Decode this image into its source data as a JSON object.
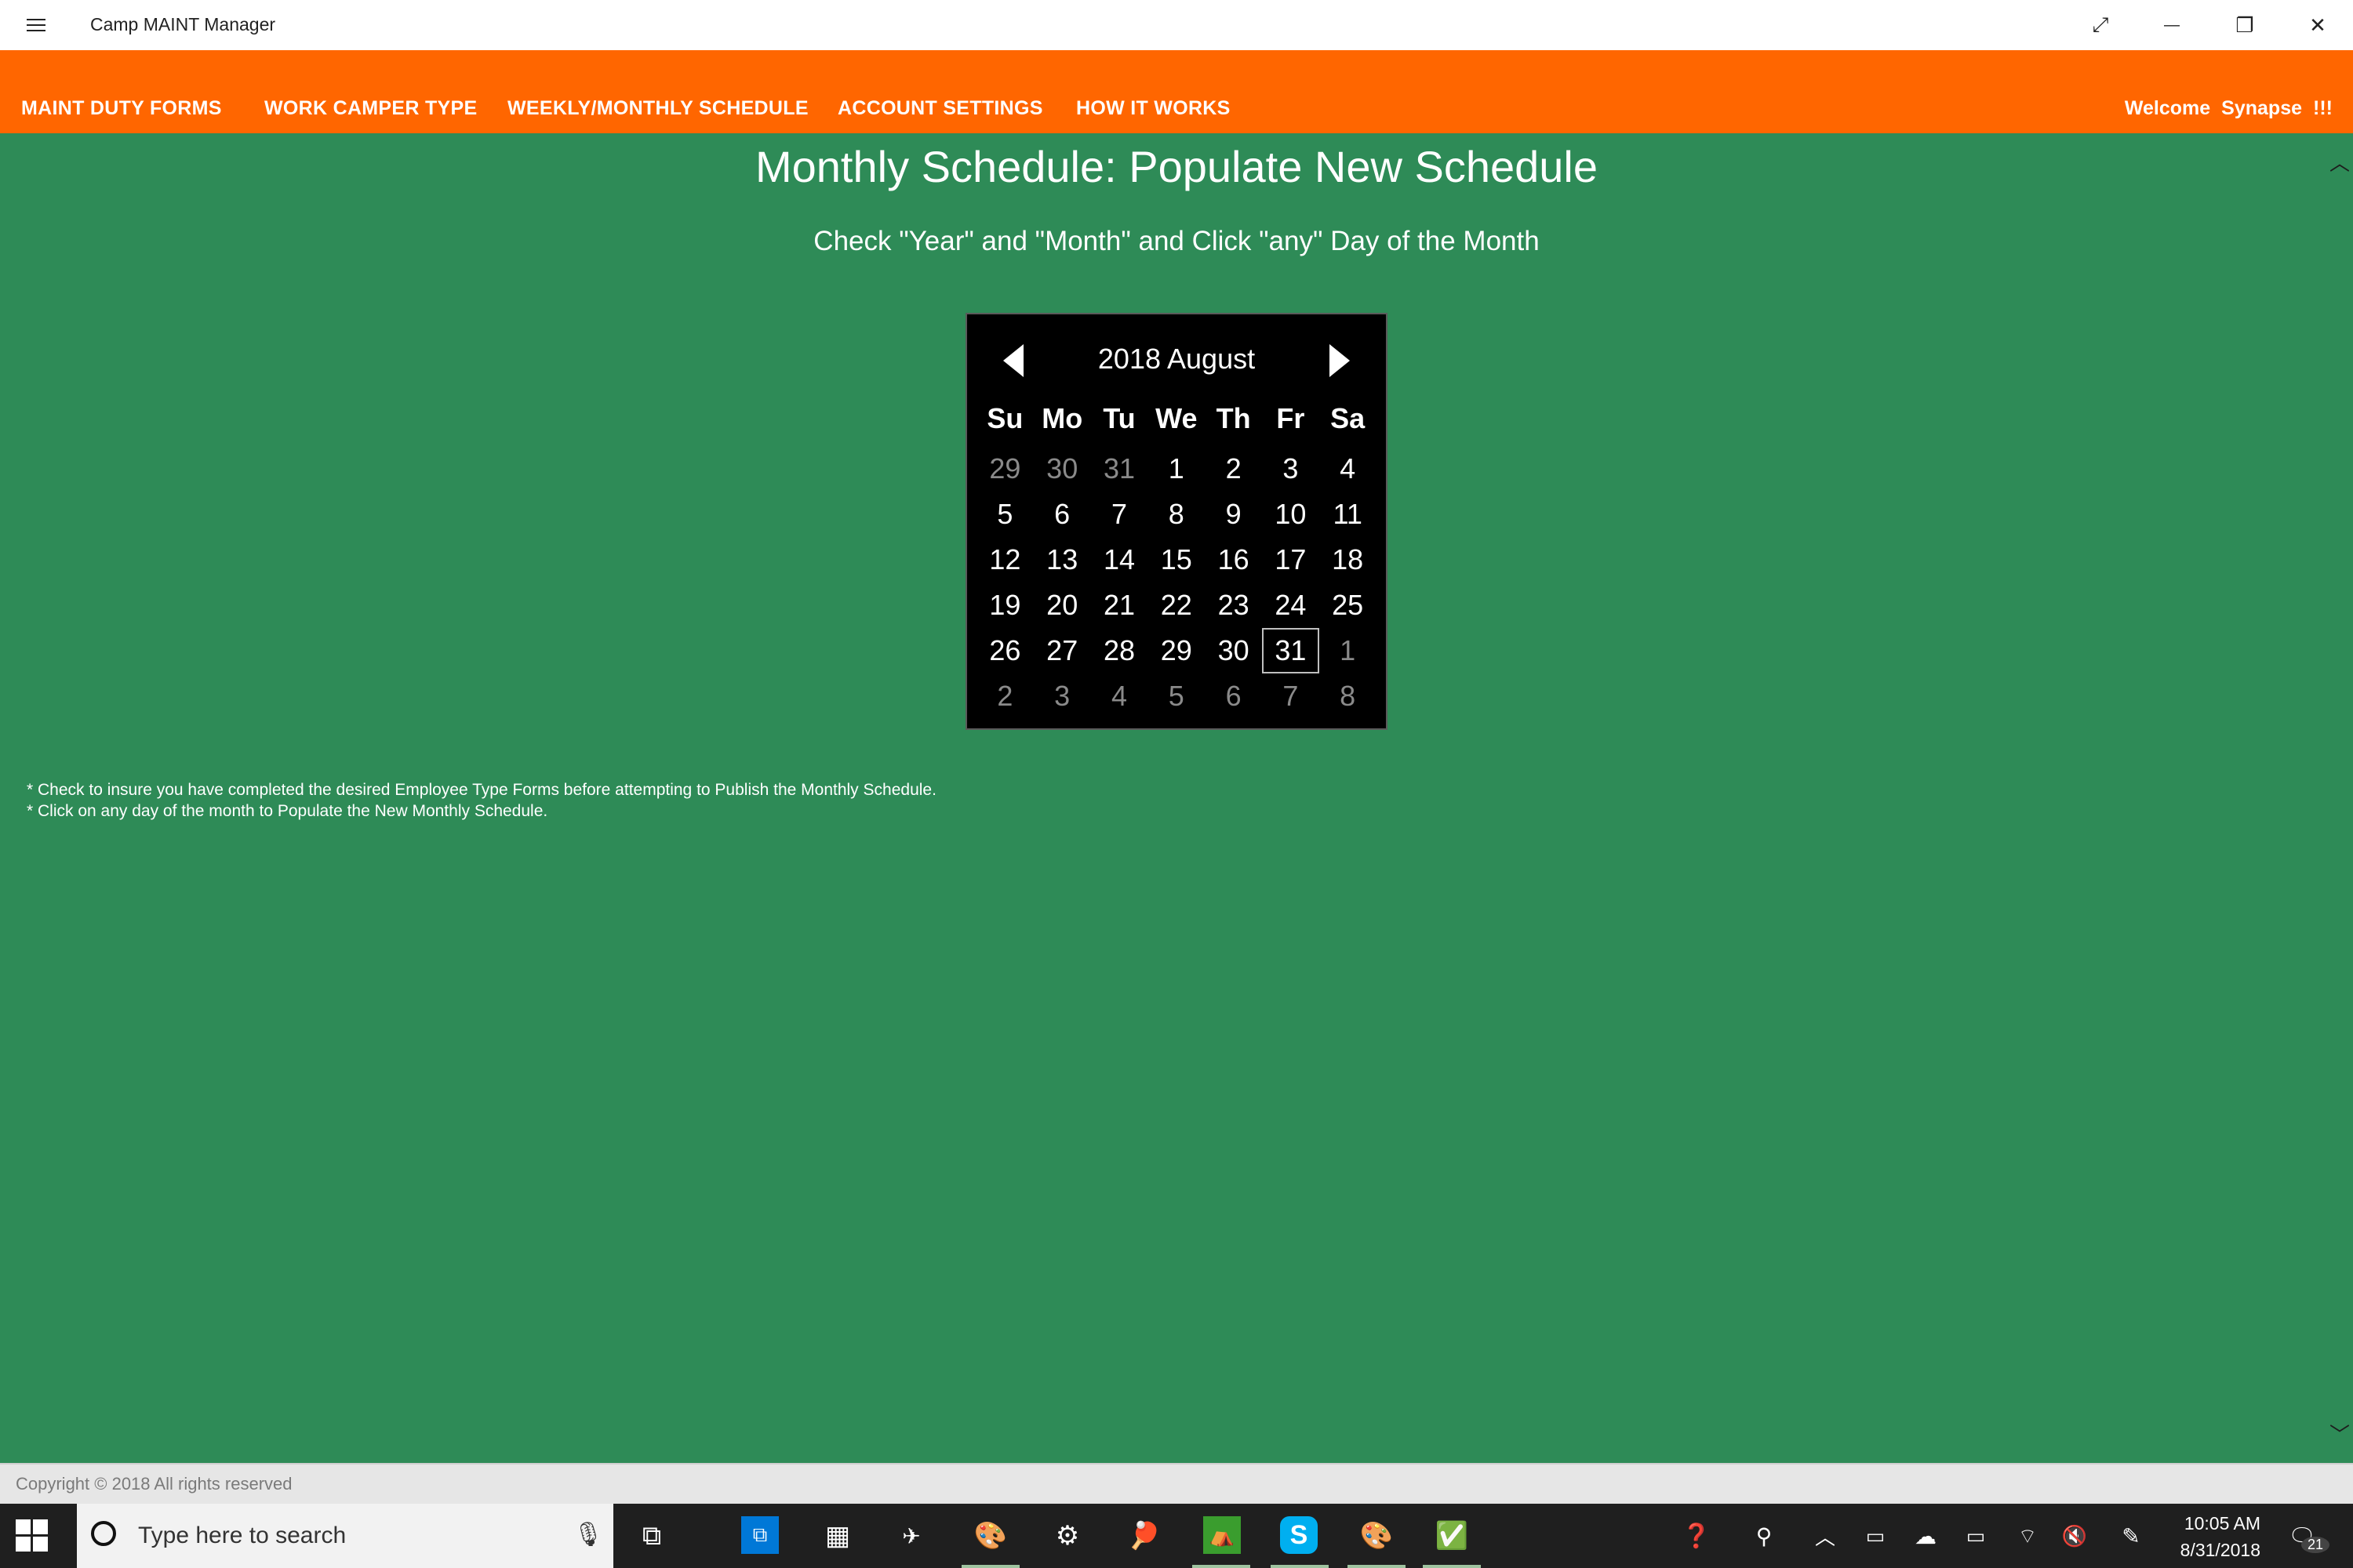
{
  "window": {
    "title": "Camp MAINT Manager",
    "controls": {
      "fullscreen": "⤢",
      "minimize": "—",
      "restore": "❐",
      "close": "✕"
    }
  },
  "nav": {
    "items": [
      {
        "label": "MAINT DUTY FORMS"
      },
      {
        "label": "WORK CAMPER TYPE"
      },
      {
        "label": "WEEKLY/MONTHLY SCHEDULE"
      },
      {
        "label": "ACCOUNT SETTINGS"
      },
      {
        "label": "HOW IT WORKS"
      }
    ],
    "welcome": {
      "text": "Welcome",
      "user": "Synapse",
      "suffix": "!!!"
    }
  },
  "page": {
    "title": "Monthly Schedule: Populate New Schedule",
    "subtitle": "Check \"Year\" and \"Month\" and Click \"any\" Day of the Month"
  },
  "calendar": {
    "header": "2018 August",
    "weekdays": [
      "Su",
      "Mo",
      "Tu",
      "We",
      "Th",
      "Fr",
      "Sa"
    ],
    "weeks": [
      [
        "29",
        "30",
        "31",
        "1",
        "2",
        "3",
        "4"
      ],
      [
        "5",
        "6",
        "7",
        "8",
        "9",
        "10",
        "11"
      ],
      [
        "12",
        "13",
        "14",
        "15",
        "16",
        "17",
        "18"
      ],
      [
        "19",
        "20",
        "21",
        "22",
        "23",
        "24",
        "25"
      ],
      [
        "26",
        "27",
        "28",
        "29",
        "30",
        "31",
        "1"
      ],
      [
        "2",
        "3",
        "4",
        "5",
        "6",
        "7",
        "8"
      ]
    ],
    "selected_day": "31"
  },
  "notes": [
    "*  Check to insure you have completed the desired Employee Type Forms before attempting to Publish the Monthly Schedule.",
    "*  Click on any day of the month to Populate the New Monthly Schedule."
  ],
  "footer": {
    "copyright": "Copyright © 2018 All rights reserved"
  },
  "taskbar": {
    "search_placeholder": "Type here to search",
    "clock": {
      "time": "10:05 AM",
      "date": "8/31/2018"
    },
    "notification_count": "21"
  },
  "colors": {
    "nav_bg": "#ff6600",
    "page_bg": "#2e8b57",
    "calendar_bg": "#000000"
  }
}
